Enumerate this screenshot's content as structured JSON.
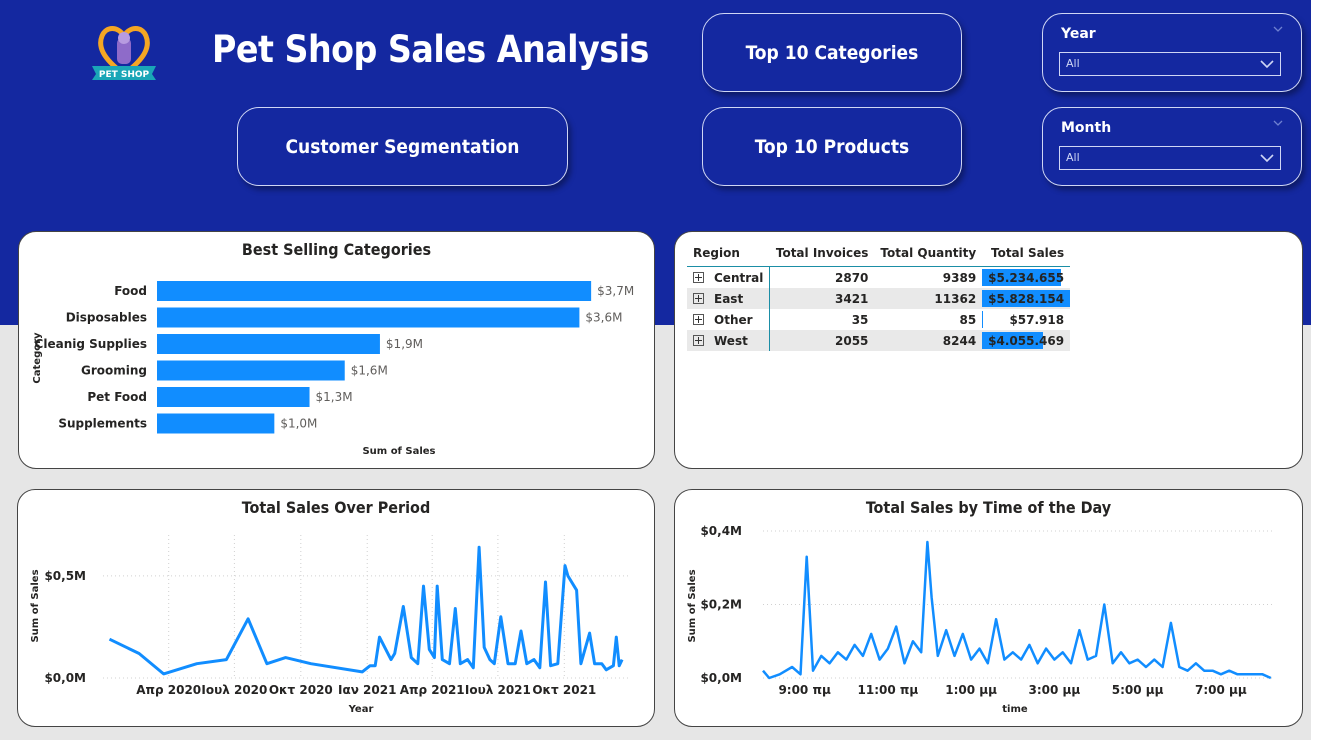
{
  "header": {
    "title": "Pet Shop Sales Analysis",
    "logo_text": "PET SHOP",
    "buttons": {
      "top10_categories": "Top 10 Categories",
      "customer_segmentation": "Customer Segmentation",
      "top10_products": "Top 10 Products"
    },
    "slicers": [
      {
        "label": "Year",
        "value": "All"
      },
      {
        "label": "Month",
        "value": "All"
      }
    ]
  },
  "colors": {
    "header_bg": "#1428a0",
    "bar": "#118dff",
    "line": "#118dff"
  },
  "region_table": {
    "columns": [
      "Region",
      "Total Invoices",
      "Total Quantity",
      "Total Sales"
    ],
    "rows": [
      {
        "region": "Central",
        "invoices": "2870",
        "quantity": "9389",
        "sales": "$5.234.655",
        "sales_value": 5234655
      },
      {
        "region": "East",
        "invoices": "3421",
        "quantity": "11362",
        "sales": "$5.828.154",
        "sales_value": 5828154
      },
      {
        "region": "Other",
        "invoices": "35",
        "quantity": "85",
        "sales": "$57.918",
        "sales_value": 57918
      },
      {
        "region": "West",
        "invoices": "2055",
        "quantity": "8244",
        "sales": "$4.055.469",
        "sales_value": 4055469
      }
    ]
  },
  "chart_data": [
    {
      "type": "bar",
      "orientation": "horizontal",
      "title": "Best Selling Categories",
      "xlabel": "Sum of Sales",
      "ylabel": "Category",
      "categories": [
        "Food",
        "Disposables",
        "Cleanig Supplies",
        "Grooming",
        "Pet Food",
        "Supplements"
      ],
      "values": [
        3.7,
        3.6,
        1.9,
        1.6,
        1.3,
        1.0
      ],
      "data_labels": [
        "$3,7M",
        "$3,6M",
        "$1,9M",
        "$1,6M",
        "$1,3M",
        "$1,0M"
      ],
      "unit": "$M",
      "grid": false
    },
    {
      "type": "line",
      "title": "Total Sales Over Period",
      "xlabel": "Year",
      "ylabel": "Sum of Sales",
      "x_ticks": [
        "Απρ 2020",
        "Ιουλ 2020",
        "Οκτ 2020",
        "Ιαν 2021",
        "Απρ 2021",
        "Ιουλ 2021",
        "Οκτ 2021"
      ],
      "y_ticks": [
        "$0,0M",
        "$0,5M"
      ],
      "ylim": [
        0,
        0.7
      ],
      "grid": true,
      "series": [
        {
          "x": [
            "2020-01-10",
            "2020-02-20",
            "2020-03-25",
            "2020-05-10",
            "2020-06-20",
            "2020-07-20",
            "2020-08-15",
            "2020-09-10",
            "2020-10-15",
            "2020-12-25",
            "2021-01-05",
            "2021-01-12",
            "2021-01-18",
            "2021-02-03",
            "2021-02-08",
            "2021-02-20",
            "2021-03-03",
            "2021-03-12",
            "2021-03-20",
            "2021-03-28",
            "2021-04-04",
            "2021-04-08",
            "2021-04-15",
            "2021-04-25",
            "2021-05-03",
            "2021-05-10",
            "2021-05-20",
            "2021-05-28",
            "2021-06-05",
            "2021-06-12",
            "2021-06-20",
            "2021-06-26",
            "2021-07-05",
            "2021-07-15",
            "2021-07-25",
            "2021-08-02",
            "2021-08-10",
            "2021-08-20",
            "2021-08-28",
            "2021-09-05",
            "2021-09-12",
            "2021-09-22",
            "2021-10-02",
            "2021-10-06",
            "2021-10-18",
            "2021-10-24",
            "2021-11-05",
            "2021-11-12",
            "2021-11-22",
            "2021-11-28",
            "2021-12-08",
            "2021-12-12",
            "2021-12-16",
            "2021-12-20"
          ],
          "y": [
            0.19,
            0.12,
            0.02,
            0.07,
            0.09,
            0.29,
            0.07,
            0.1,
            0.07,
            0.03,
            0.06,
            0.06,
            0.2,
            0.09,
            0.12,
            0.35,
            0.1,
            0.07,
            0.45,
            0.14,
            0.1,
            0.45,
            0.09,
            0.07,
            0.34,
            0.07,
            0.09,
            0.05,
            0.64,
            0.15,
            0.09,
            0.07,
            0.3,
            0.07,
            0.07,
            0.23,
            0.07,
            0.09,
            0.05,
            0.47,
            0.06,
            0.07,
            0.55,
            0.5,
            0.43,
            0.07,
            0.22,
            0.07,
            0.07,
            0.04,
            0.06,
            0.2,
            0.06,
            0.09
          ]
        }
      ]
    },
    {
      "type": "line",
      "title": "Total Sales by Time of the Day",
      "xlabel": "time",
      "ylabel": "Sum of Sales",
      "x_ticks": [
        "9:00 πμ",
        "11:00 πμ",
        "1:00 μμ",
        "3:00 μμ",
        "5:00 μμ",
        "7:00 μμ"
      ],
      "y_ticks": [
        "$0,0M",
        "$0,2M",
        "$0,4M"
      ],
      "ylim": [
        0,
        0.4
      ],
      "grid": true,
      "series": [
        {
          "x_hours": [
            8.0,
            8.15,
            8.4,
            8.7,
            8.9,
            9.05,
            9.2,
            9.4,
            9.6,
            9.8,
            10.0,
            10.2,
            10.4,
            10.6,
            10.8,
            11.0,
            11.2,
            11.4,
            11.6,
            11.8,
            11.95,
            12.05,
            12.2,
            12.4,
            12.6,
            12.8,
            13.0,
            13.2,
            13.4,
            13.6,
            13.8,
            14.0,
            14.2,
            14.4,
            14.6,
            14.8,
            15.0,
            15.2,
            15.4,
            15.6,
            15.8,
            16.0,
            16.2,
            16.4,
            16.6,
            16.8,
            17.0,
            17.2,
            17.4,
            17.6,
            17.8,
            18.0,
            18.2,
            18.4,
            18.6,
            18.8,
            19.0,
            19.2,
            19.4,
            19.6,
            19.8,
            20.0,
            20.2
          ],
          "y": [
            0.02,
            0.0,
            0.01,
            0.03,
            0.01,
            0.33,
            0.02,
            0.06,
            0.04,
            0.07,
            0.05,
            0.09,
            0.06,
            0.12,
            0.05,
            0.08,
            0.14,
            0.04,
            0.1,
            0.07,
            0.37,
            0.22,
            0.06,
            0.13,
            0.06,
            0.12,
            0.05,
            0.08,
            0.04,
            0.16,
            0.05,
            0.07,
            0.05,
            0.09,
            0.04,
            0.08,
            0.05,
            0.07,
            0.04,
            0.13,
            0.05,
            0.06,
            0.2,
            0.04,
            0.07,
            0.04,
            0.05,
            0.03,
            0.05,
            0.03,
            0.15,
            0.03,
            0.02,
            0.04,
            0.02,
            0.02,
            0.01,
            0.02,
            0.01,
            0.01,
            0.01,
            0.01,
            0.0
          ]
        }
      ]
    }
  ]
}
